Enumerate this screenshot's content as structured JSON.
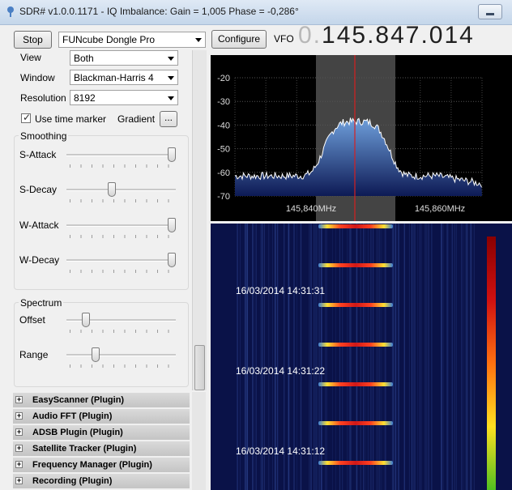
{
  "window": {
    "title": "SDR# v1.0.0.1171 - IQ Imbalance: Gain = 1,005 Phase = -0,286°"
  },
  "toolbar": {
    "stop_label": "Stop",
    "device_selected": "FUNcube Dongle Pro",
    "configure_label": "Configure",
    "vfo_label": "VFO",
    "vfo_prefix": "0.",
    "vfo_value": "145.847.014"
  },
  "fft_display": {
    "view_label": "View",
    "view_value": "Both",
    "window_label": "Window",
    "window_value": "Blackman-Harris 4",
    "resolution_label": "Resolution",
    "resolution_value": "8192",
    "time_marker_label": "Use time marker",
    "time_marker_checked": true,
    "gradient_label": "Gradient",
    "gradient_button": "..."
  },
  "smoothing": {
    "title": "Smoothing",
    "sliders": [
      {
        "label": "S-Attack",
        "level": 1.0
      },
      {
        "label": "S-Decay",
        "level": 0.41
      },
      {
        "label": "W-Attack",
        "level": 1.0
      },
      {
        "label": "W-Decay",
        "level": 1.0
      }
    ]
  },
  "spectrum_group": {
    "title": "Spectrum",
    "sliders": [
      {
        "label": "Offset",
        "level": 0.15
      },
      {
        "label": "Range",
        "level": 0.25
      }
    ]
  },
  "plugins": [
    {
      "label": "EasyScanner (Plugin)"
    },
    {
      "label": "Audio FFT (Plugin)"
    },
    {
      "label": "ADSB Plugin (Plugin)"
    },
    {
      "label": "Satellite Tracker (Plugin)"
    },
    {
      "label": "Frequency Manager (Plugin)"
    },
    {
      "label": "Recording (Plugin)"
    }
  ],
  "spectrum": {
    "y_ticks": [
      "-20",
      "-30",
      "-40",
      "-50",
      "-60",
      "-70"
    ],
    "x_ticks": [
      "145,840MHz",
      "145,860MHz"
    ]
  },
  "waterfall": {
    "timestamps": [
      "16/03/2014 14:31:31",
      "16/03/2014 14:31:22",
      "16/03/2014 14:31:12"
    ]
  },
  "colors": {
    "spectrum_fill": "#3a6ab3",
    "center_line": "#d62020",
    "waterfall_bg": "#0a1248"
  }
}
